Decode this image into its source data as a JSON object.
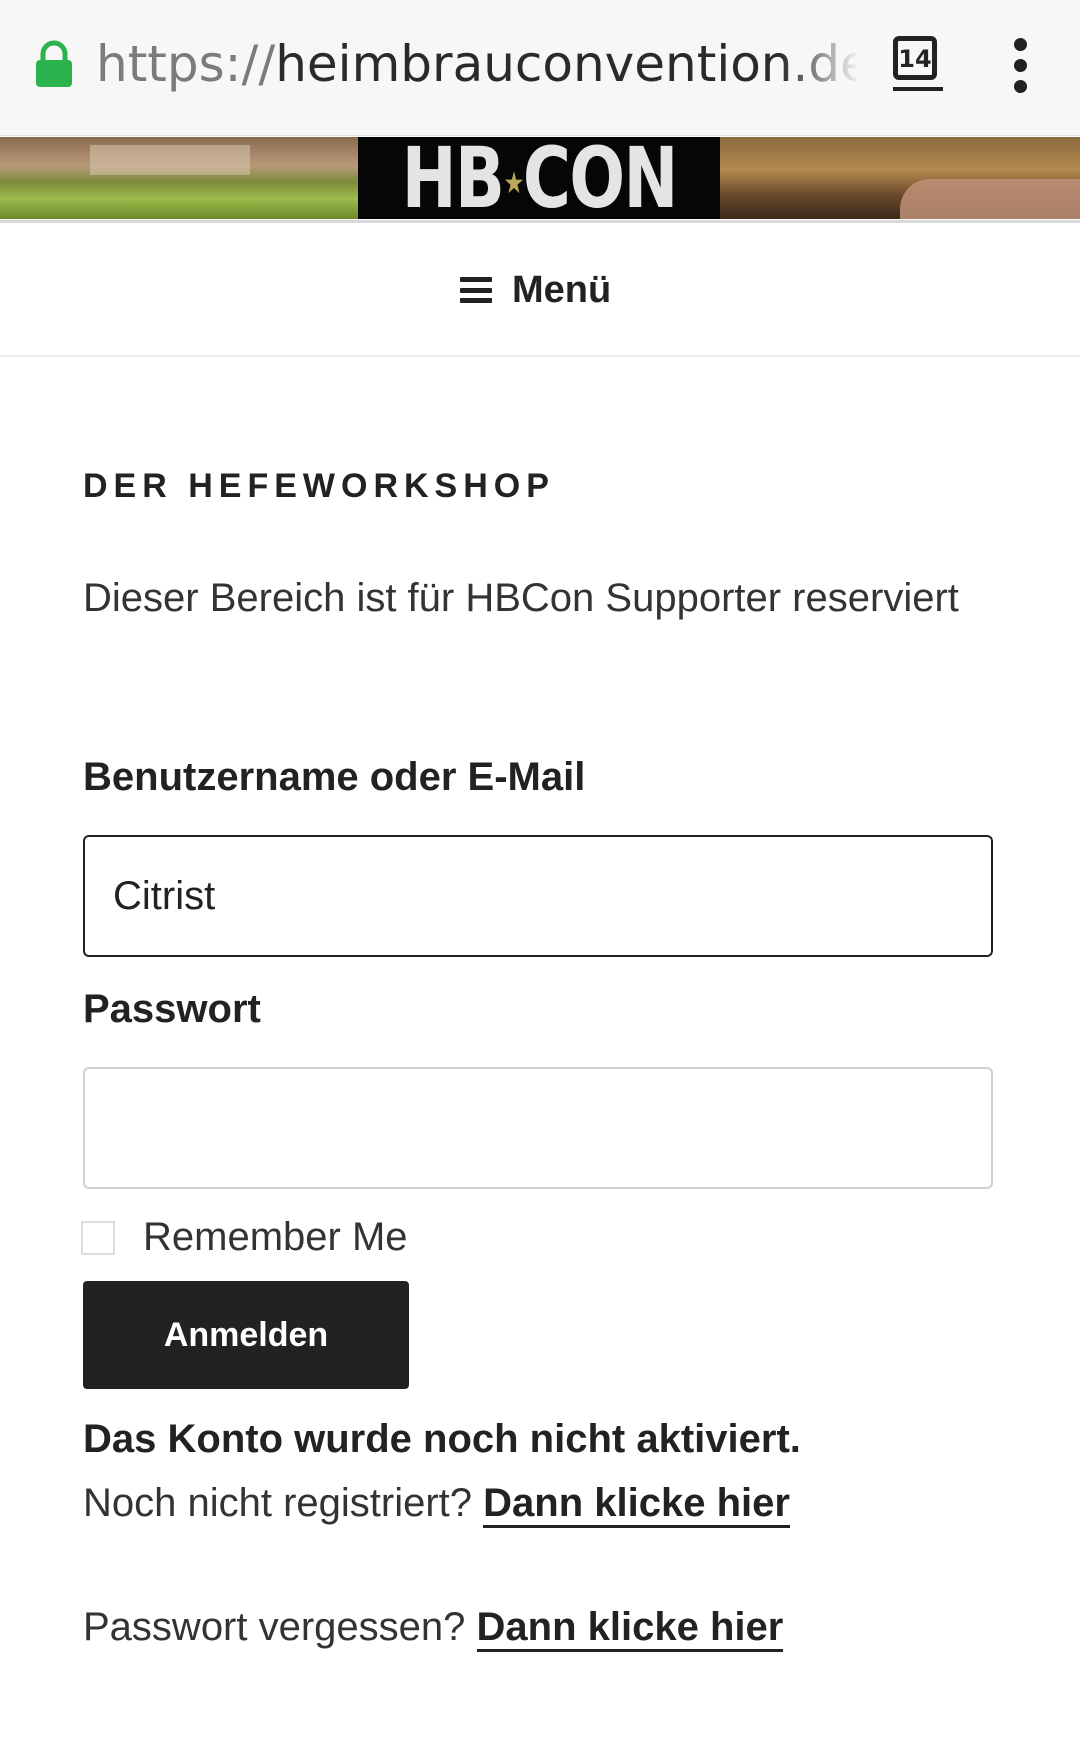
{
  "browser": {
    "url_scheme": "https://",
    "url_host": "heimbrauconvention.de/in",
    "tab_count": "14",
    "icons": {
      "lock": "lock-icon",
      "tabs": "tab-switcher-icon",
      "menu": "overflow-menu-icon"
    },
    "lock_color": "#2bb24c"
  },
  "banner": {
    "title_left": "HB",
    "title_right": "CON",
    "star": "★"
  },
  "nav": {
    "menu_label": "Menü"
  },
  "main": {
    "section_title": "DER HEFEWORKSHOP",
    "intro": "Dieser Bereich ist für HBCon Supporter reserviert"
  },
  "form": {
    "username_label": "Benutzername oder E-Mail",
    "username_value": "Citrist",
    "password_label": "Passwort",
    "password_value": "",
    "remember_label": "Remember Me",
    "remember_checked": false,
    "submit_label": "Anmelden"
  },
  "messages": {
    "not_activated": "Das Konto wurde noch nicht aktiviert.",
    "register_prompt": "Noch nicht registriert?",
    "register_link": "Dann klicke hier",
    "forgot_prompt": "Passwort vergessen?",
    "forgot_link": "Dann klicke hier"
  }
}
